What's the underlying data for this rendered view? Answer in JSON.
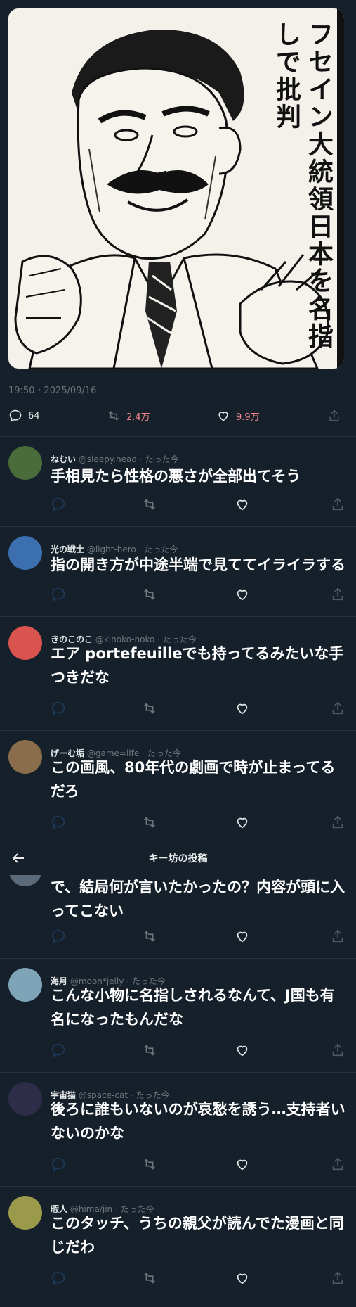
{
  "post": {
    "caption": "フセイン大統領日本を名指しで批判",
    "timestamp": "19:50・2025/09/16",
    "stats": {
      "replies": "64",
      "retweets": "2.4万",
      "likes": "9.9万"
    }
  },
  "header": {
    "title": "キー坊の投稿"
  },
  "replies": [
    {
      "name": "ねむい",
      "handle": "@sleepy.head",
      "time": "たった今",
      "text": "手相見たら性格の悪さが全部出てそう",
      "avatar_color": "#4a6b3a"
    },
    {
      "name": "光の戦士",
      "handle": "@light-hero",
      "time": "たった今",
      "text": "指の開き方が中途半端で見ててイライラする",
      "avatar_color": "#3b6fb0"
    },
    {
      "name": "きのこのこ",
      "handle": "@kinoko-noko",
      "time": "たった今",
      "text": "エア portefeuilleでも持ってるみたいな手つきだな",
      "avatar_color": "#d9534f"
    },
    {
      "name": "げーむ垢",
      "handle": "@game=life",
      "time": "たった今",
      "text": "この画風、80年代の劇画で時が止まってるだろ",
      "avatar_color": "#8a6d4a"
    },
    {
      "name": "海月",
      "handle": "@moon*jelly",
      "time": "たった今",
      "text": "こんな小物に名指しされるなんて、J国も有名になったもんだな",
      "avatar_color": "#7fa4b8"
    },
    {
      "name": "宇宙猫",
      "handle": "@space-cat",
      "time": "たった今",
      "text": "後ろに誰もいないのが哀愁を誘う…支持者いないのかな",
      "avatar_color": "#2d2d4a"
    },
    {
      "name": "暇人",
      "handle": "@hima/jin",
      "time": "たった今",
      "text": "このタッチ、うちの親父が読んでた漫画と同じだわ",
      "avatar_color": "#9a9a4a"
    }
  ],
  "partial_reply": {
    "text": "で、結局何が言いたかったの？内容が頭に入ってこない"
  },
  "colors": {
    "background": "#15202b",
    "accent_pink": "#f4858e",
    "muted": "#71767b"
  }
}
